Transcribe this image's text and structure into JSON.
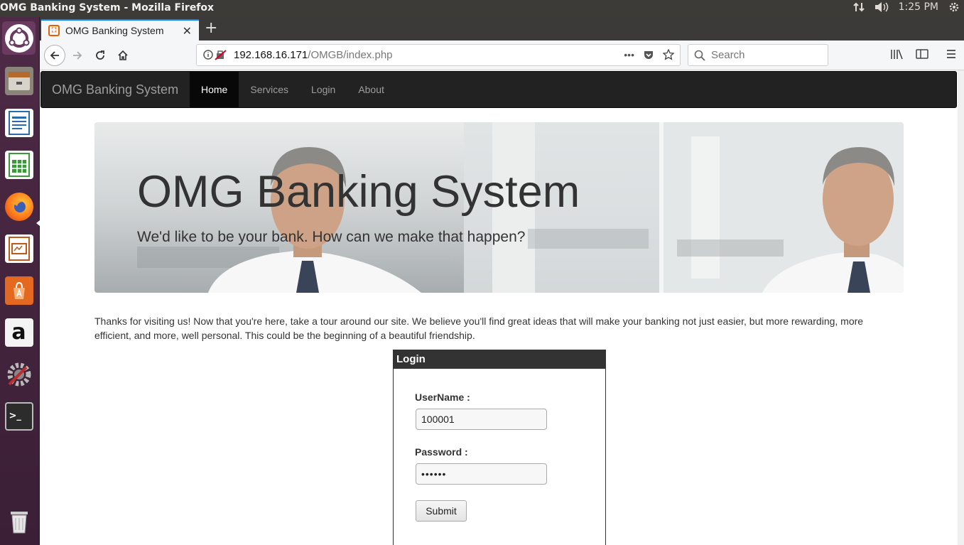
{
  "window": {
    "title": "OMG Banking System - Mozilla Firefox"
  },
  "tray": {
    "clock": "1:25 PM"
  },
  "launcher": {
    "items": [
      {
        "name": "ubuntu-dash-icon"
      },
      {
        "name": "files-icon"
      },
      {
        "name": "writer-icon"
      },
      {
        "name": "calc-icon"
      },
      {
        "name": "firefox-icon"
      },
      {
        "name": "impress-icon"
      },
      {
        "name": "software-center-icon"
      },
      {
        "name": "amazon-icon",
        "glyph": "a"
      },
      {
        "name": "system-settings-icon"
      },
      {
        "name": "terminal-icon",
        "glyph": ">_"
      },
      {
        "name": "trash-icon"
      }
    ]
  },
  "browser": {
    "tab_title": "OMG Banking System",
    "url_host": "192.168.16.171",
    "url_path": "/OMGB/index.php",
    "search_placeholder": "Search"
  },
  "site": {
    "brand": "OMG Banking System",
    "nav": [
      "Home",
      "Services",
      "Login",
      "About"
    ],
    "active_nav": "Home",
    "hero_title": "OMG Banking System",
    "hero_subtitle": "We'd like to be your bank. How can we make that happen?",
    "intro": "Thanks for visiting us! Now that you're here, take a tour around our site. We believe you'll find great ideas that will make your banking not just easier, but more rewarding, more efficient, and more, well personal. This could be the beginning of a beautiful friendship."
  },
  "login": {
    "header": "Login",
    "username_label": "UserName :",
    "username_value": "100001",
    "password_label": "Password :",
    "password_value": "••••••",
    "submit_label": "Submit"
  },
  "colors": {
    "site_nav_bg": "#222222",
    "launcher_bg": "#4e2a46",
    "tab_accent": "#0a84ff"
  }
}
